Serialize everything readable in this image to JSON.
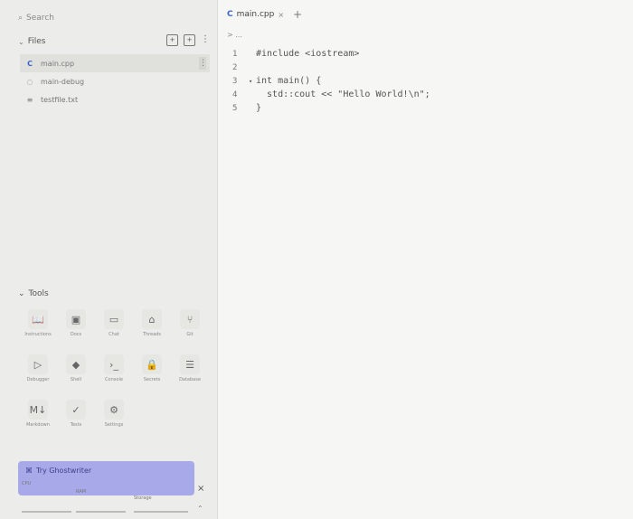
{
  "search": {
    "placeholder": "Search",
    "icon": "search-icon"
  },
  "files": {
    "title": "Files",
    "items": [
      {
        "name": "main.cpp",
        "icon": "cpp-file-icon",
        "active": true
      },
      {
        "name": "main-debug",
        "icon": "binary-icon",
        "active": false
      },
      {
        "name": "testfile.txt",
        "icon": "text-file-icon",
        "active": false
      }
    ]
  },
  "tools": {
    "title": "Tools",
    "items": [
      {
        "label": "Instructions",
        "icon": "book-icon"
      },
      {
        "label": "Docs",
        "icon": "docs-icon"
      },
      {
        "label": "Chat",
        "icon": "chat-icon"
      },
      {
        "label": "Threads",
        "icon": "inbox-icon"
      },
      {
        "label": "Git",
        "icon": "git-icon"
      },
      {
        "label": "Debugger",
        "icon": "debugger-icon"
      },
      {
        "label": "Shell",
        "icon": "shell-icon"
      },
      {
        "label": "Console",
        "icon": "console-icon"
      },
      {
        "label": "Secrets",
        "icon": "lock-icon"
      },
      {
        "label": "Database",
        "icon": "database-icon"
      },
      {
        "label": "Markdown",
        "icon": "markdown-icon"
      },
      {
        "label": "Tests",
        "icon": "check-icon"
      },
      {
        "label": "Settings",
        "icon": "gear-icon"
      }
    ]
  },
  "ghostwriter": {
    "label": "Try Ghostwriter"
  },
  "resources": {
    "cpu": "CPU",
    "ram": "RAM",
    "storage": "Storage"
  },
  "editor": {
    "tab": {
      "label": "main.cpp"
    },
    "breadcrumb": "> ...",
    "lines": [
      {
        "n": "1",
        "fold": "",
        "text": "#include <iostream>"
      },
      {
        "n": "2",
        "fold": "",
        "text": ""
      },
      {
        "n": "3",
        "fold": "▾",
        "text": "int main() {"
      },
      {
        "n": "4",
        "fold": "",
        "text": "  std::cout << \"Hello World!\\n\";"
      },
      {
        "n": "5",
        "fold": "",
        "text": "}"
      }
    ]
  },
  "colors": {
    "ghostwriter_bg": "#a7a9e8",
    "accent": "#3a63c9"
  }
}
